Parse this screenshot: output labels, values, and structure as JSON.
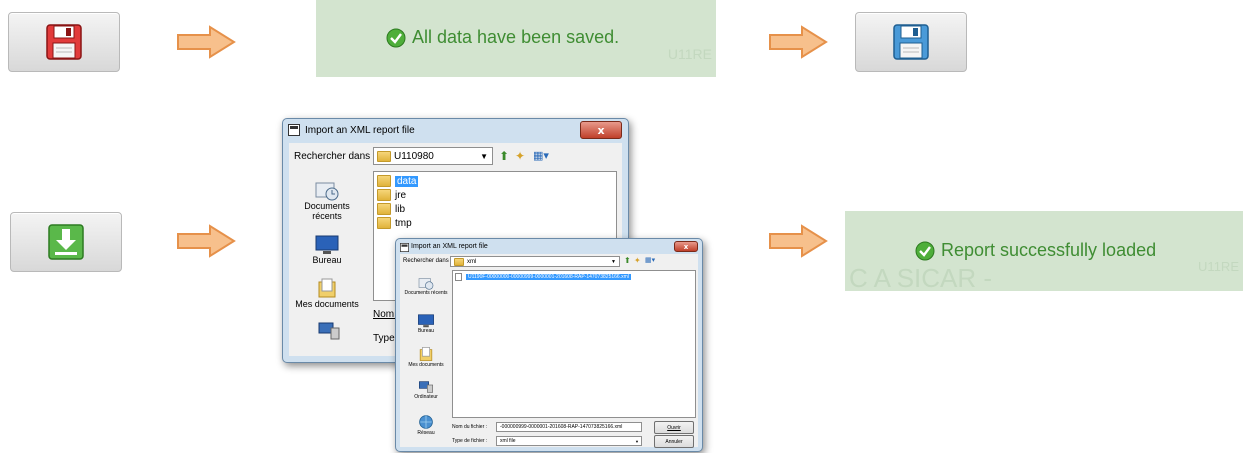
{
  "row1": {
    "saved_banner": {
      "message": "All data have been saved.",
      "ghost_text": "U11RE"
    },
    "icons": {
      "dirty": "floppy-disk-red-icon",
      "clean": "floppy-disk-blue-icon",
      "arrow": "arrow-right-icon"
    }
  },
  "row2": {
    "import_button_icon": "download-green-icon",
    "dialog_main": {
      "title": "Import an XML report file",
      "look_in_label": "Rechercher dans :",
      "look_in_value": "U110980",
      "close_label": "x",
      "sidebar": [
        {
          "label": "Documents récents",
          "icon": "recent-documents-icon"
        },
        {
          "label": "Bureau",
          "icon": "desktop-icon"
        },
        {
          "label": "Mes documents",
          "icon": "my-documents-icon"
        }
      ],
      "files": [
        "data",
        "jre",
        "lib",
        "tmp"
      ],
      "filename_label": "Nom d",
      "filetype_label": "Type d"
    },
    "dialog_second": {
      "title": "Import an XML report file",
      "look_in_label": "Rechercher dans :",
      "look_in_value": "xml",
      "sidebar": [
        {
          "label": "Documents récents",
          "icon": "recent-documents-icon"
        },
        {
          "label": "Bureau",
          "icon": "desktop-icon"
        },
        {
          "label": "Mes documents",
          "icon": "my-documents-icon"
        },
        {
          "label": "Ordinateur",
          "icon": "computer-icon"
        },
        {
          "label": "Réseau",
          "icon": "network-icon"
        }
      ],
      "selected_file": "U1190F-00000000-00000999-0000001-201608-RAP-147073825166.xml",
      "filename_label": "Nom du fichier :",
      "filename_value": "-000000999-0000001-201608-RAP-147073825166.xml",
      "filetype_label": "Type de fichier :",
      "filetype_value": "xml file",
      "open_button": "Ouvrir",
      "cancel_button": "Annuler"
    },
    "loaded_banner": {
      "message": "Report successfully loaded",
      "ghost_left": "C A   SICAR -",
      "ghost_right": "U11RE"
    }
  },
  "colors": {
    "banner_bg": "#d3e4cf",
    "banner_text": "#3f8d33",
    "arrow_fill": "#f7c08c",
    "arrow_stroke": "#e6914a"
  }
}
